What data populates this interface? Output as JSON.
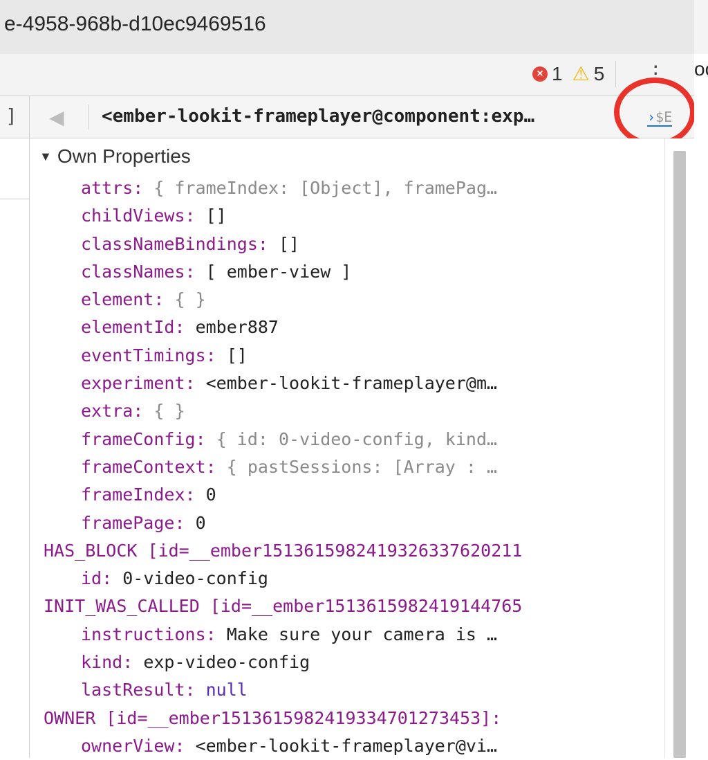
{
  "window": {
    "title": "e-4958-968b-d10ec9469516"
  },
  "toolbar": {
    "errors": "1",
    "warnings": "5",
    "right_cutoff": "oc"
  },
  "left_panel": {
    "bracket": "]"
  },
  "object_header": {
    "title": "<ember-lookit-frameplayer@component:exp…",
    "store_as_global": "$E"
  },
  "section": {
    "label": "Own Properties",
    "collapsed": false
  },
  "properties": [
    {
      "key": "attrs",
      "value": "{ frameIndex: [Object], framePag…",
      "style": "gray",
      "level": "indent"
    },
    {
      "key": "childViews",
      "value": "[]",
      "style": "dark",
      "level": "indent"
    },
    {
      "key": "classNameBindings",
      "value": "[]",
      "style": "dark",
      "level": "indent"
    },
    {
      "key": "classNames",
      "value": "[ ember-view ]",
      "style": "dark",
      "level": "indent"
    },
    {
      "key": "element",
      "value": "{ }",
      "style": "gray",
      "level": "indent"
    },
    {
      "key": "elementId",
      "value": "ember887",
      "style": "dark",
      "level": "indent"
    },
    {
      "key": "eventTimings",
      "value": "[]",
      "style": "dark",
      "level": "indent"
    },
    {
      "key": "experiment",
      "value": "<ember-lookit-frameplayer@m…",
      "style": "dark",
      "level": "indent"
    },
    {
      "key": "extra",
      "value": "{ }",
      "style": "gray",
      "level": "indent"
    },
    {
      "key": "frameConfig",
      "value": "{ id: 0-video-config, kind…",
      "style": "gray",
      "level": "indent"
    },
    {
      "key": "frameContext",
      "value": "{ pastSessions: [Array : …",
      "style": "gray",
      "level": "indent"
    },
    {
      "key": "frameIndex",
      "value": "0",
      "style": "dark",
      "level": "indent"
    },
    {
      "key": "framePage",
      "value": "0",
      "style": "dark",
      "level": "indent"
    },
    {
      "key": "HAS_BLOCK [id=__ember15136159824193263376202​11",
      "value": "",
      "style": "sym",
      "level": "top"
    },
    {
      "key": "id",
      "value": "0-video-config",
      "style": "dark",
      "level": "indent"
    },
    {
      "key": "INIT_WAS_CALLED [id=__ember1513615982419144765",
      "value": "",
      "style": "sym",
      "level": "top"
    },
    {
      "key": "instructions",
      "value": "Make sure your camera is …",
      "style": "dark",
      "level": "indent"
    },
    {
      "key": "kind",
      "value": "exp-video-config",
      "style": "dark",
      "level": "indent"
    },
    {
      "key": "lastResult",
      "value": "null",
      "style": "null",
      "level": "indent"
    },
    {
      "key": "OWNER [id=__ember1513615982419334701273453]:",
      "value": "",
      "style": "sym",
      "level": "top"
    },
    {
      "key": "ownerView",
      "value": "<ember-lookit-frameplayer@vi…",
      "style": "dark",
      "level": "indent"
    }
  ],
  "colors": {
    "key": "#8b1a8b",
    "value_dark": "#222222",
    "value_gray": "#8a8a8a",
    "highlight_ring": "#e8322a",
    "link": "#1a73e8"
  }
}
